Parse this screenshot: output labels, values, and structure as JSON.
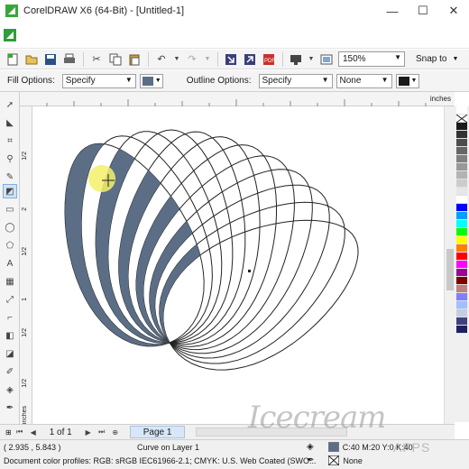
{
  "window": {
    "title": "CorelDRAW X6 (64-Bit) - [Untitled-1]",
    "minimize": "—",
    "maximize": "☐",
    "close": "✕"
  },
  "toolbar": {
    "zoom_value": "150%",
    "snap_label": "Snap to"
  },
  "property_bar": {
    "fill_options_label": "Fill Options:",
    "fill_options_value": "Specify",
    "fill_swatch_color": "#5b6e86",
    "outline_options_label": "Outline Options:",
    "outline_options_value": "Specify",
    "outline_width_value": "None",
    "outline_swatch_color": "#1a1a1a"
  },
  "ruler": {
    "units": "inches",
    "left_labels": [
      "1/2",
      "2",
      "1/2",
      "1",
      "1/2",
      "1/2",
      "inches"
    ]
  },
  "pagebar": {
    "page_count": "1 of 1",
    "page_tab": "Page 1"
  },
  "status": {
    "coordinates": "( 2.935 , 5.843 )",
    "layer": "Curve on Layer 1",
    "color_profiles": "Document color profiles: RGB: sRGB IEC61966-2.1; CMYK: U.S. Web Coated (SWO...",
    "fill_info": "C:40 M:20 Y:0 K:40",
    "outline_info": "None"
  },
  "watermark": {
    "main": "Icecream",
    "sub": "APPS"
  },
  "palette": {
    "colors": [
      "#ffffff",
      "#000000",
      "#1a1a1a",
      "#333333",
      "#4d4d4d",
      "#666666",
      "#808080",
      "#999999",
      "#b3b3b3",
      "#cccccc",
      "#e6e6e6",
      "#ffffff",
      "#0000ff",
      "#00a0ff",
      "#00ffff",
      "#00ff00",
      "#ffff00",
      "#ff8000",
      "#ff0000",
      "#ff00ff",
      "#a000a0",
      "#800000",
      "#c08080",
      "#8080ff",
      "#a0c0ff",
      "#c0d0e0",
      "#404080",
      "#202060"
    ]
  },
  "colors": {
    "shape_fill": "#5b6e86",
    "cursor_highlight": "#f5f06a"
  }
}
